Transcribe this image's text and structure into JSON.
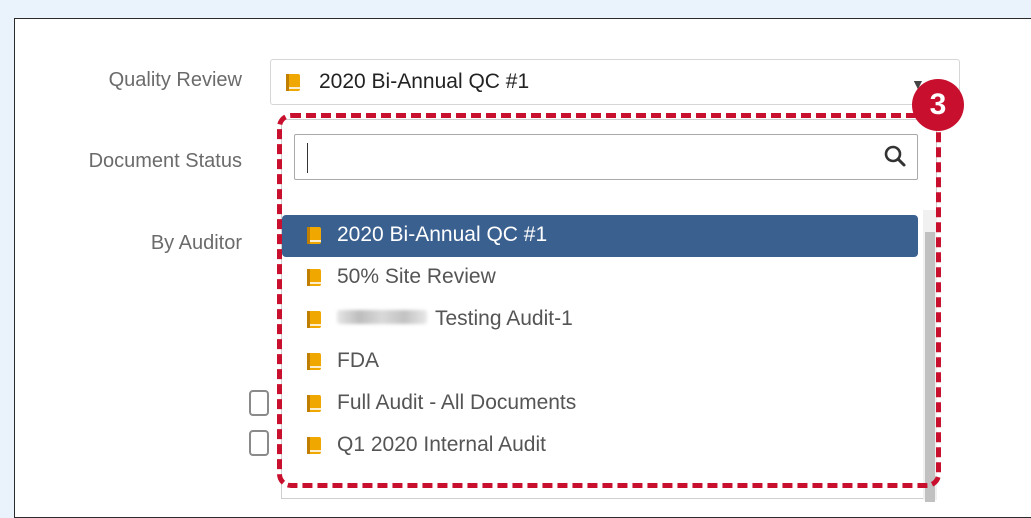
{
  "form": {
    "quality_review_label": "Quality Review",
    "document_status_label": "Document Status",
    "by_auditor_label": "By Auditor",
    "selected_value": "2020 Bi-Annual QC #1"
  },
  "dropdown": {
    "search_value": "",
    "search_icon": "search-icon",
    "items": [
      {
        "label": "2020 Bi-Annual QC #1",
        "selected": true
      },
      {
        "label": "50% Site Review",
        "selected": false
      },
      {
        "label": "Testing Audit-1",
        "selected": false
      },
      {
        "label": "FDA",
        "selected": false
      },
      {
        "label": "Full Audit - All Documents",
        "selected": false
      },
      {
        "label": "Q1 2020 Internal Audit",
        "selected": false
      }
    ]
  },
  "annotation": {
    "step_number": "3",
    "color": "#c8102e"
  },
  "colors": {
    "selected_bg": "#3a6090",
    "book_icon": "#f0a800"
  }
}
